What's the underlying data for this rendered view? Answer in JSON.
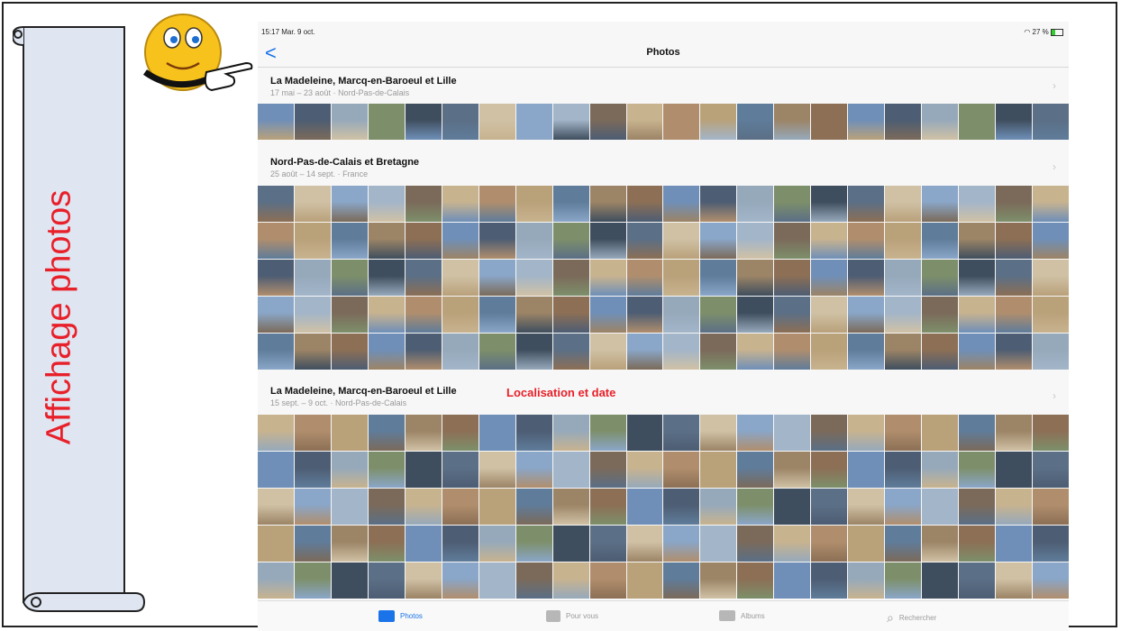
{
  "banner": {
    "title": "Affichage photos"
  },
  "status": {
    "time": "15:17  Mar. 9 oct.",
    "battery": "27 %"
  },
  "nav": {
    "back": "<",
    "title": "Photos"
  },
  "moments": [
    {
      "title": "La Madeleine, Marcq-en-Baroeul et Lille",
      "dates": "17 mai – 23 août",
      "place": "Nord-Pas-de-Calais"
    },
    {
      "title": "Nord-Pas-de-Calais et Bretagne",
      "dates": "25 août – 14 sept.",
      "place": "France"
    },
    {
      "title": "La Madeleine, Marcq-en-Baroeul et Lille",
      "dates": "15 sept. – 9 oct.",
      "place": "Nord-Pas-de-Calais"
    }
  ],
  "annotation": "Localisation et date",
  "tabs": [
    {
      "label": "Photos",
      "icon": "photos-icon"
    },
    {
      "label": "Pour vous",
      "icon": "for-you-icon"
    },
    {
      "label": "Albums",
      "icon": "albums-icon"
    },
    {
      "label": "Rechercher",
      "icon": "search-icon"
    }
  ],
  "colors": {
    "annotation": "#e8202a",
    "accent": "#1a73e8",
    "banner_fill": "#dfe6f2"
  }
}
